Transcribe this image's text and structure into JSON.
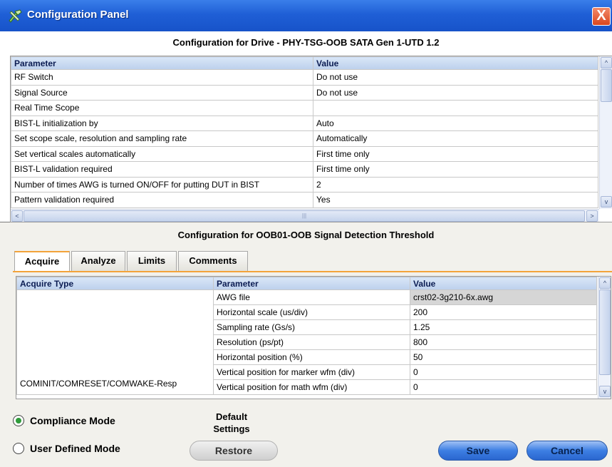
{
  "window": {
    "title": "Configuration Panel",
    "close_glyph": "X",
    "app_icon": "tools-icon",
    "close_icon": "close-icon"
  },
  "drive_config": {
    "title": "Configuration for Drive - PHY-TSG-OOB SATA Gen 1-UTD 1.2",
    "headers": [
      "Parameter",
      "Value"
    ],
    "rows": [
      {
        "parameter": "RF Switch",
        "value": "Do not use"
      },
      {
        "parameter": "Signal Source",
        "value": "Do not use"
      },
      {
        "parameter": "Real Time Scope",
        "value": ""
      },
      {
        "parameter": "BIST-L initialization by",
        "value": "Auto"
      },
      {
        "parameter": "Set scope scale, resolution and sampling rate",
        "value": "Automatically"
      },
      {
        "parameter": "Set vertical scales automatically",
        "value": "First time only"
      },
      {
        "parameter": "BIST-L validation required",
        "value": "First time only"
      },
      {
        "parameter": "Number of times AWG is turned ON/OFF for putting DUT in BIST",
        "value": "2"
      },
      {
        "parameter": "Pattern validation required",
        "value": "Yes"
      }
    ],
    "scroll_up": "^",
    "scroll_down": "v",
    "scroll_left": "<",
    "scroll_right": ">",
    "scroll_grip": "|||"
  },
  "test_config": {
    "title": "Configuration for OOB01-OOB Signal Detection Threshold",
    "tabs": [
      "Acquire",
      "Analyze",
      "Limits",
      "Comments"
    ],
    "active_tab": "Acquire",
    "headers": [
      "Acquire Type",
      "Parameter",
      "Value"
    ],
    "acquire_type": "COMINIT/COMRESET/COMWAKE-Resp",
    "rows": [
      {
        "parameter": "AWG file",
        "value": "crst02-3g210-6x.awg"
      },
      {
        "parameter": "Horizontal scale (us/div)",
        "value": "200"
      },
      {
        "parameter": "Sampling rate (Gs/s)",
        "value": "1.25"
      },
      {
        "parameter": "Resolution (ps/pt)",
        "value": "800"
      },
      {
        "parameter": "Horizontal position (%)",
        "value": "50"
      },
      {
        "parameter": "Vertical position for marker wfm (div)",
        "value": "0"
      },
      {
        "parameter": "Vertical position for math wfm (div)",
        "value": "0"
      }
    ],
    "scroll_up": "^",
    "scroll_down": "v"
  },
  "mode": {
    "compliance_label": "Compliance Mode",
    "user_defined_label": "User Defined Mode",
    "selected": "Compliance Mode"
  },
  "default_settings_line1": "Default",
  "default_settings_line2": "Settings",
  "buttons": {
    "restore": "Restore",
    "save": "Save",
    "cancel": "Cancel"
  }
}
